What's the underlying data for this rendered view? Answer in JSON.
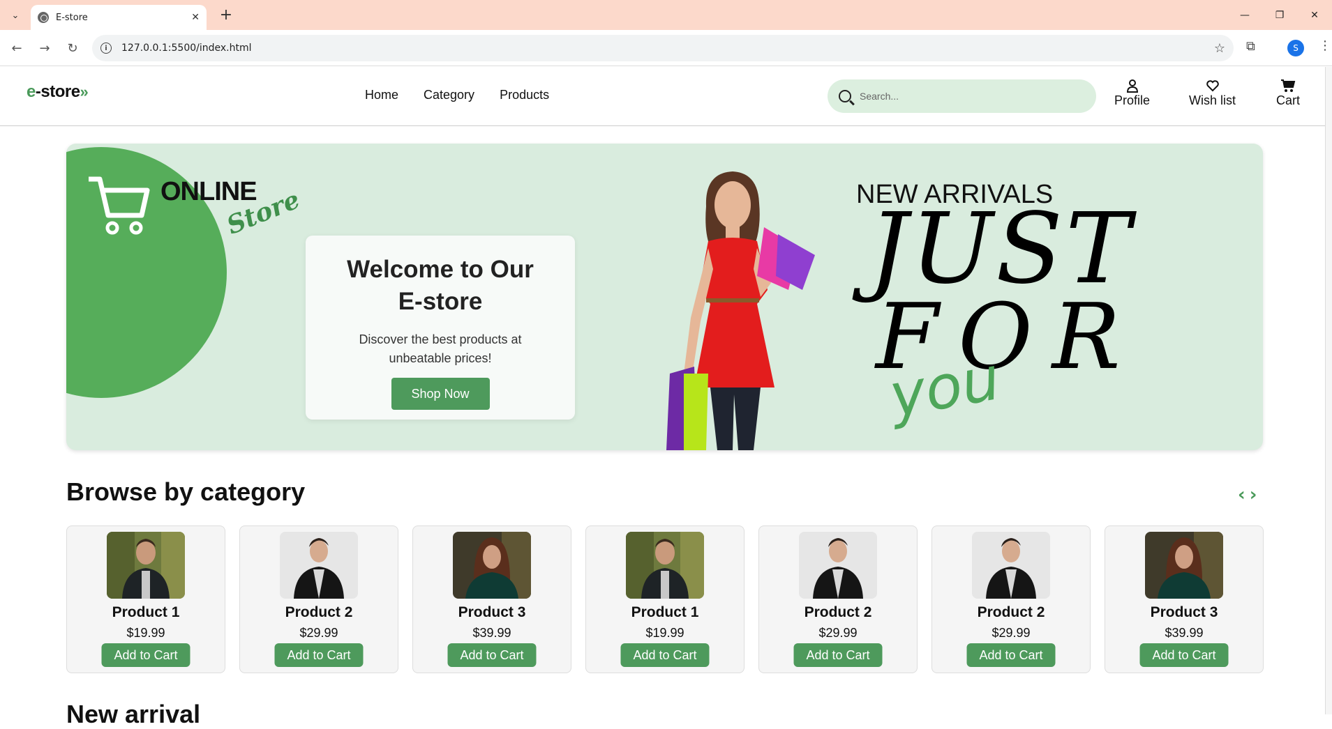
{
  "browser": {
    "tab_title": "E-store",
    "url": "127.0.0.1:5500/index.html",
    "profile_initial": "S"
  },
  "header": {
    "logo_prefix": "e",
    "logo_main": "-store",
    "logo_arrows": "»",
    "nav": [
      "Home",
      "Category",
      "Products"
    ],
    "search_placeholder": "Search...",
    "actions": [
      {
        "label": "Profile",
        "icon": "user-icon"
      },
      {
        "label": "Wish list",
        "icon": "heart-icon"
      },
      {
        "label": "Cart",
        "icon": "cart-icon"
      }
    ]
  },
  "hero": {
    "online": "ONLINE",
    "store": "Store",
    "welcome_title_line1": "Welcome to Our",
    "welcome_title_line2": "E-store",
    "welcome_sub_line1": "Discover the best products at",
    "welcome_sub_line2": "unbeatable prices!",
    "shop_button": "Shop Now",
    "arrivals": "NEW ARRIVALS",
    "just": "JUST",
    "for": "FOR",
    "you": "you"
  },
  "category": {
    "title": "Browse by category",
    "prev": "‹",
    "next": "›",
    "products": [
      {
        "name": "Product 1",
        "price": "$19.99",
        "button": "Add to Cart",
        "photo": "man-forest"
      },
      {
        "name": "Product 2",
        "price": "$29.99",
        "button": "Add to Cart",
        "photo": "man-leather"
      },
      {
        "name": "Product 3",
        "price": "$39.99",
        "button": "Add to Cart",
        "photo": "woman-green"
      },
      {
        "name": "Product 1",
        "price": "$19.99",
        "button": "Add to Cart",
        "photo": "man-forest"
      },
      {
        "name": "Product 2",
        "price": "$29.99",
        "button": "Add to Cart",
        "photo": "man-leather"
      },
      {
        "name": "Product 2",
        "price": "$29.99",
        "button": "Add to Cart",
        "photo": "man-leather"
      },
      {
        "name": "Product 3",
        "price": "$39.99",
        "button": "Add to Cart",
        "photo": "woman-green"
      }
    ]
  },
  "new_arrival": {
    "title": "New arrival"
  },
  "colors": {
    "accent": "#4e9a5c",
    "hero_bg": "#d9ecde",
    "tabbar": "#fcd9cb"
  }
}
